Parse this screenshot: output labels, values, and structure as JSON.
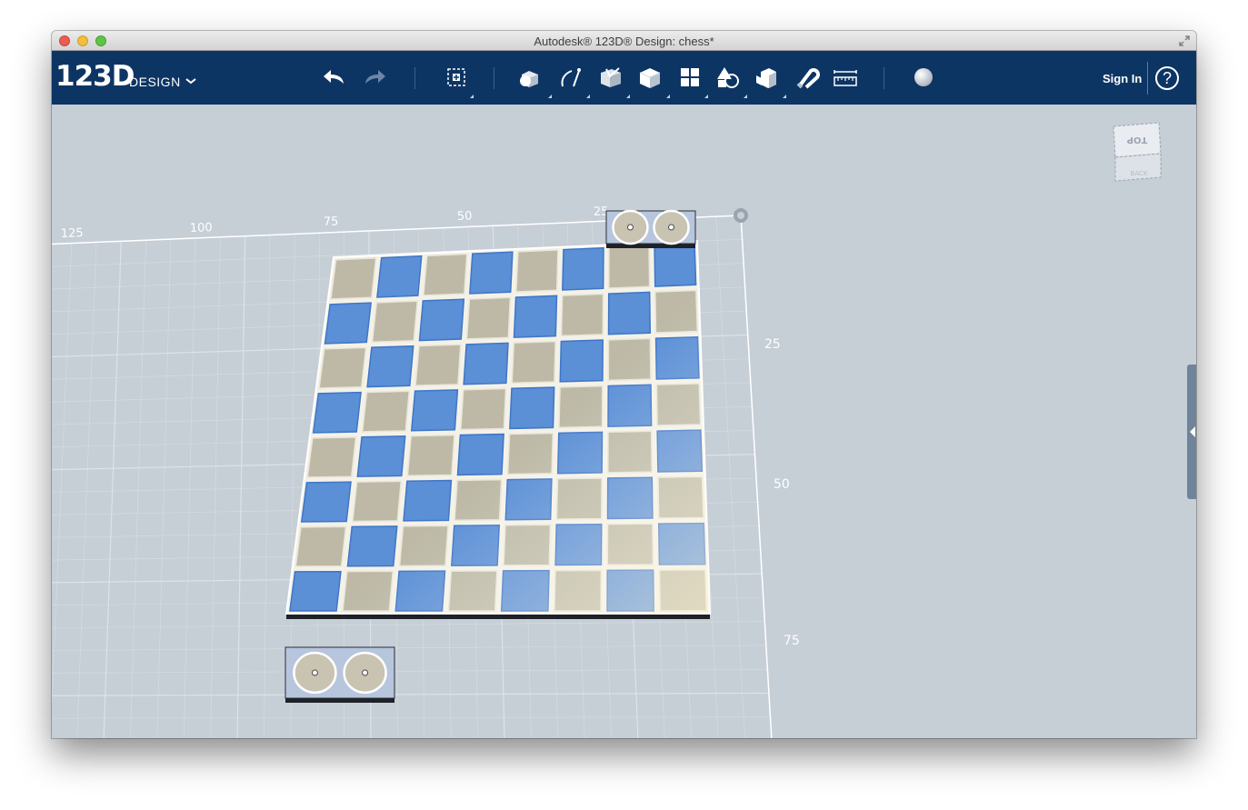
{
  "window": {
    "title": "Autodesk® 123D® Design: chess*"
  },
  "app": {
    "logo": "123D",
    "logo_sub": "DESIGN",
    "sign_in": "Sign In",
    "help": "?"
  },
  "toolbar": {
    "tools": [
      "undo-icon",
      "redo-icon",
      "transform-icon",
      "primitives-icon",
      "sketch-icon",
      "construct-icon",
      "modify-icon",
      "pattern-icon",
      "grouping-icon",
      "combine-icon",
      "snap-icon",
      "measure-icon",
      "material-icon"
    ]
  },
  "viewport": {
    "axis_top": [
      "125",
      "100",
      "75",
      "50",
      "25"
    ],
    "axis_right": [
      "25",
      "50",
      "75"
    ],
    "view_cube": {
      "top": "TOP",
      "front": "BACK"
    }
  },
  "colors": {
    "toolbar": "#0d3564",
    "canvas": "#c6ced6",
    "tile_blue": "#5b8fd6",
    "tile_tan": "#bdb9a6",
    "tile_edge_blue": "#3f76c8"
  }
}
